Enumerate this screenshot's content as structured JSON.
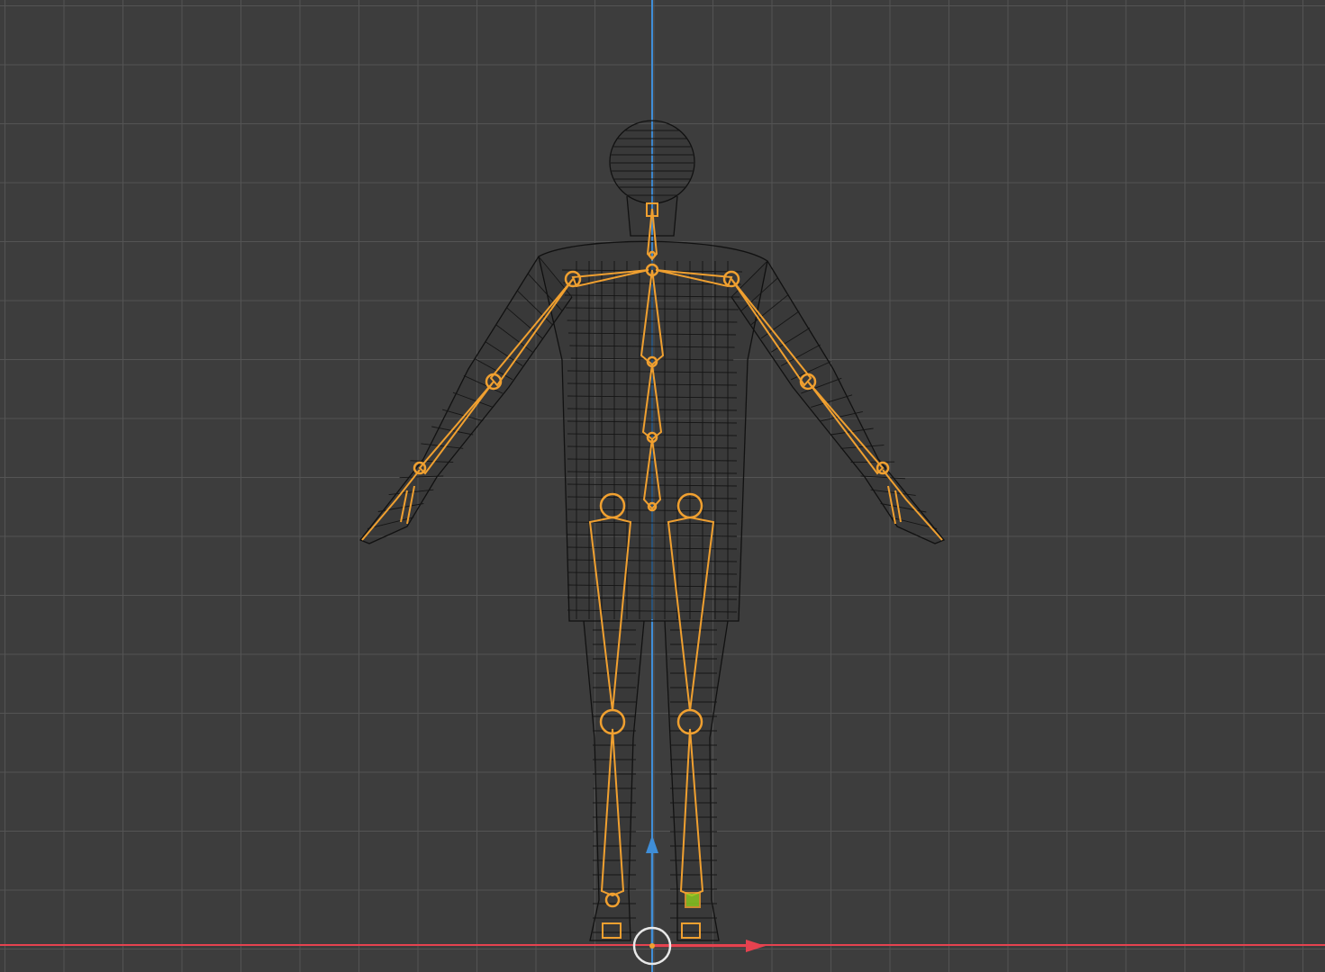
{
  "viewport": {
    "view": "front-orthographic",
    "display_mode": "wireframe",
    "background_color": "#3d3d3d",
    "grid_color": "#545454"
  },
  "scene": {
    "object": "humanoid-mesh-with-armature",
    "armature_selected": true,
    "armature_color": "#f0a030",
    "mesh_wire_color": "#111111",
    "active_bone_color": "#8fd020"
  },
  "axes": {
    "x_color": "#e6424f",
    "z_color": "#3f8ed8"
  },
  "gizmo": {
    "type": "move",
    "icons": [
      "z-arrow-icon",
      "x-arrow-icon",
      "origin-circle-icon"
    ]
  }
}
